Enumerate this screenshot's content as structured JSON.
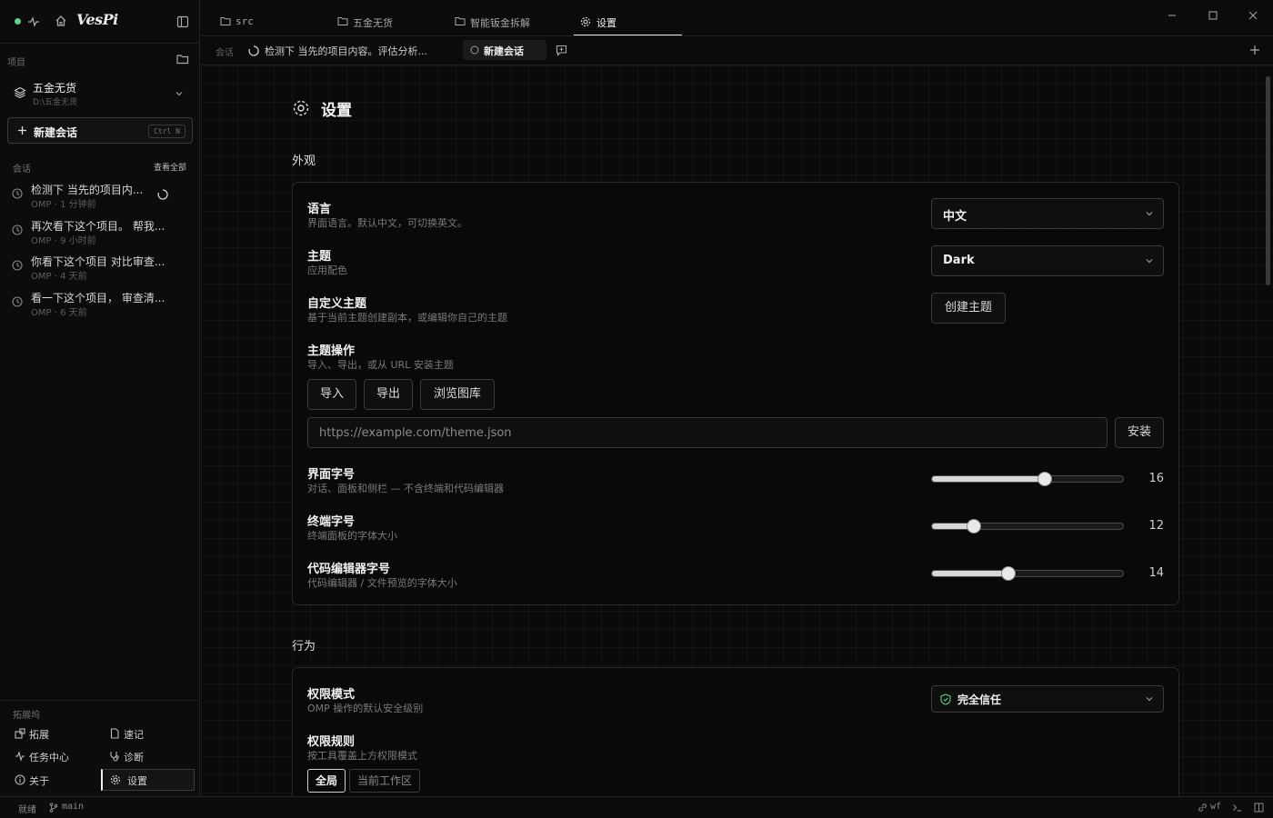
{
  "app": {
    "logo": "VesPi"
  },
  "sidebar": {
    "project_label": "项目",
    "project_name": "五金无货",
    "project_path": "D:\\五金无货",
    "new_session_label": "新建会话",
    "new_session_shortcut": "Ctrl N",
    "sessions_label": "会话",
    "view_all": "查看全部",
    "sessions": [
      {
        "title": "检测下 当先的项目内...",
        "meta": "OMP · 1 分钟前"
      },
      {
        "title": "再次看下这个项目。 帮我...",
        "meta": "OMP · 9 小时前"
      },
      {
        "title": "你看下这个项目 对比审查...",
        "meta": "OMP · 4 天前"
      },
      {
        "title": "看一下这个项目， 审查清...",
        "meta": "OMP · 6 天前"
      }
    ],
    "ext_label": "拓展坞",
    "ext_items": [
      "拓展",
      "速记",
      "任务中心",
      "诊断",
      "关于",
      "设置"
    ]
  },
  "tabs": [
    "src",
    "五金无货",
    "智能钣金拆解",
    "设置"
  ],
  "subbar": {
    "label": "会话",
    "current_session": "检测下 当先的项目内容。评估分析...",
    "new_session": "新建会话"
  },
  "settings": {
    "title": "设置",
    "appearance_heading": "外观",
    "language_title": "语言",
    "language_desc": "界面语言。默认中文，可切换英文。",
    "language_value": "中文",
    "theme_title": "主题",
    "theme_desc": "应用配色",
    "theme_value": "Dark",
    "custom_theme_title": "自定义主题",
    "custom_theme_desc": "基于当前主题创建副本，或编辑你自己的主题",
    "create_theme": "创建主题",
    "theme_ops_title": "主题操作",
    "theme_ops_desc": "导入、导出，或从 URL 安装主题",
    "import": "导入",
    "export": "导出",
    "browse_gallery": "浏览图库",
    "url_placeholder": "https://example.com/theme.json",
    "install": "安装",
    "ui_font_title": "界面字号",
    "ui_font_desc": "对话、面板和侧栏 — 不含终端和代码编辑器",
    "ui_font_value": "16",
    "term_font_title": "终端字号",
    "term_font_desc": "终端面板的字体大小",
    "term_font_value": "12",
    "editor_font_title": "代码编辑器字号",
    "editor_font_desc": "代码编辑器 / 文件预览的字体大小",
    "editor_font_value": "14",
    "behavior_heading": "行为",
    "perm_mode_title": "权限模式",
    "perm_mode_desc": "OMP 操作的默认安全级别",
    "perm_mode_value": "完全信任",
    "perm_rules_title": "权限规则",
    "perm_rules_desc": "按工具覆盖上方权限模式",
    "scope_global": "全局",
    "scope_workspace": "当前工作区"
  },
  "sliders": {
    "ui_font": 0.59,
    "term_font": 0.22,
    "editor_font": 0.4
  },
  "status": {
    "ready": "就绪",
    "branch": "main",
    "user": "wf"
  },
  "colors": {
    "accent": "#5fd18a",
    "background": "#0a0a0a",
    "border": "#2a2a2a"
  }
}
